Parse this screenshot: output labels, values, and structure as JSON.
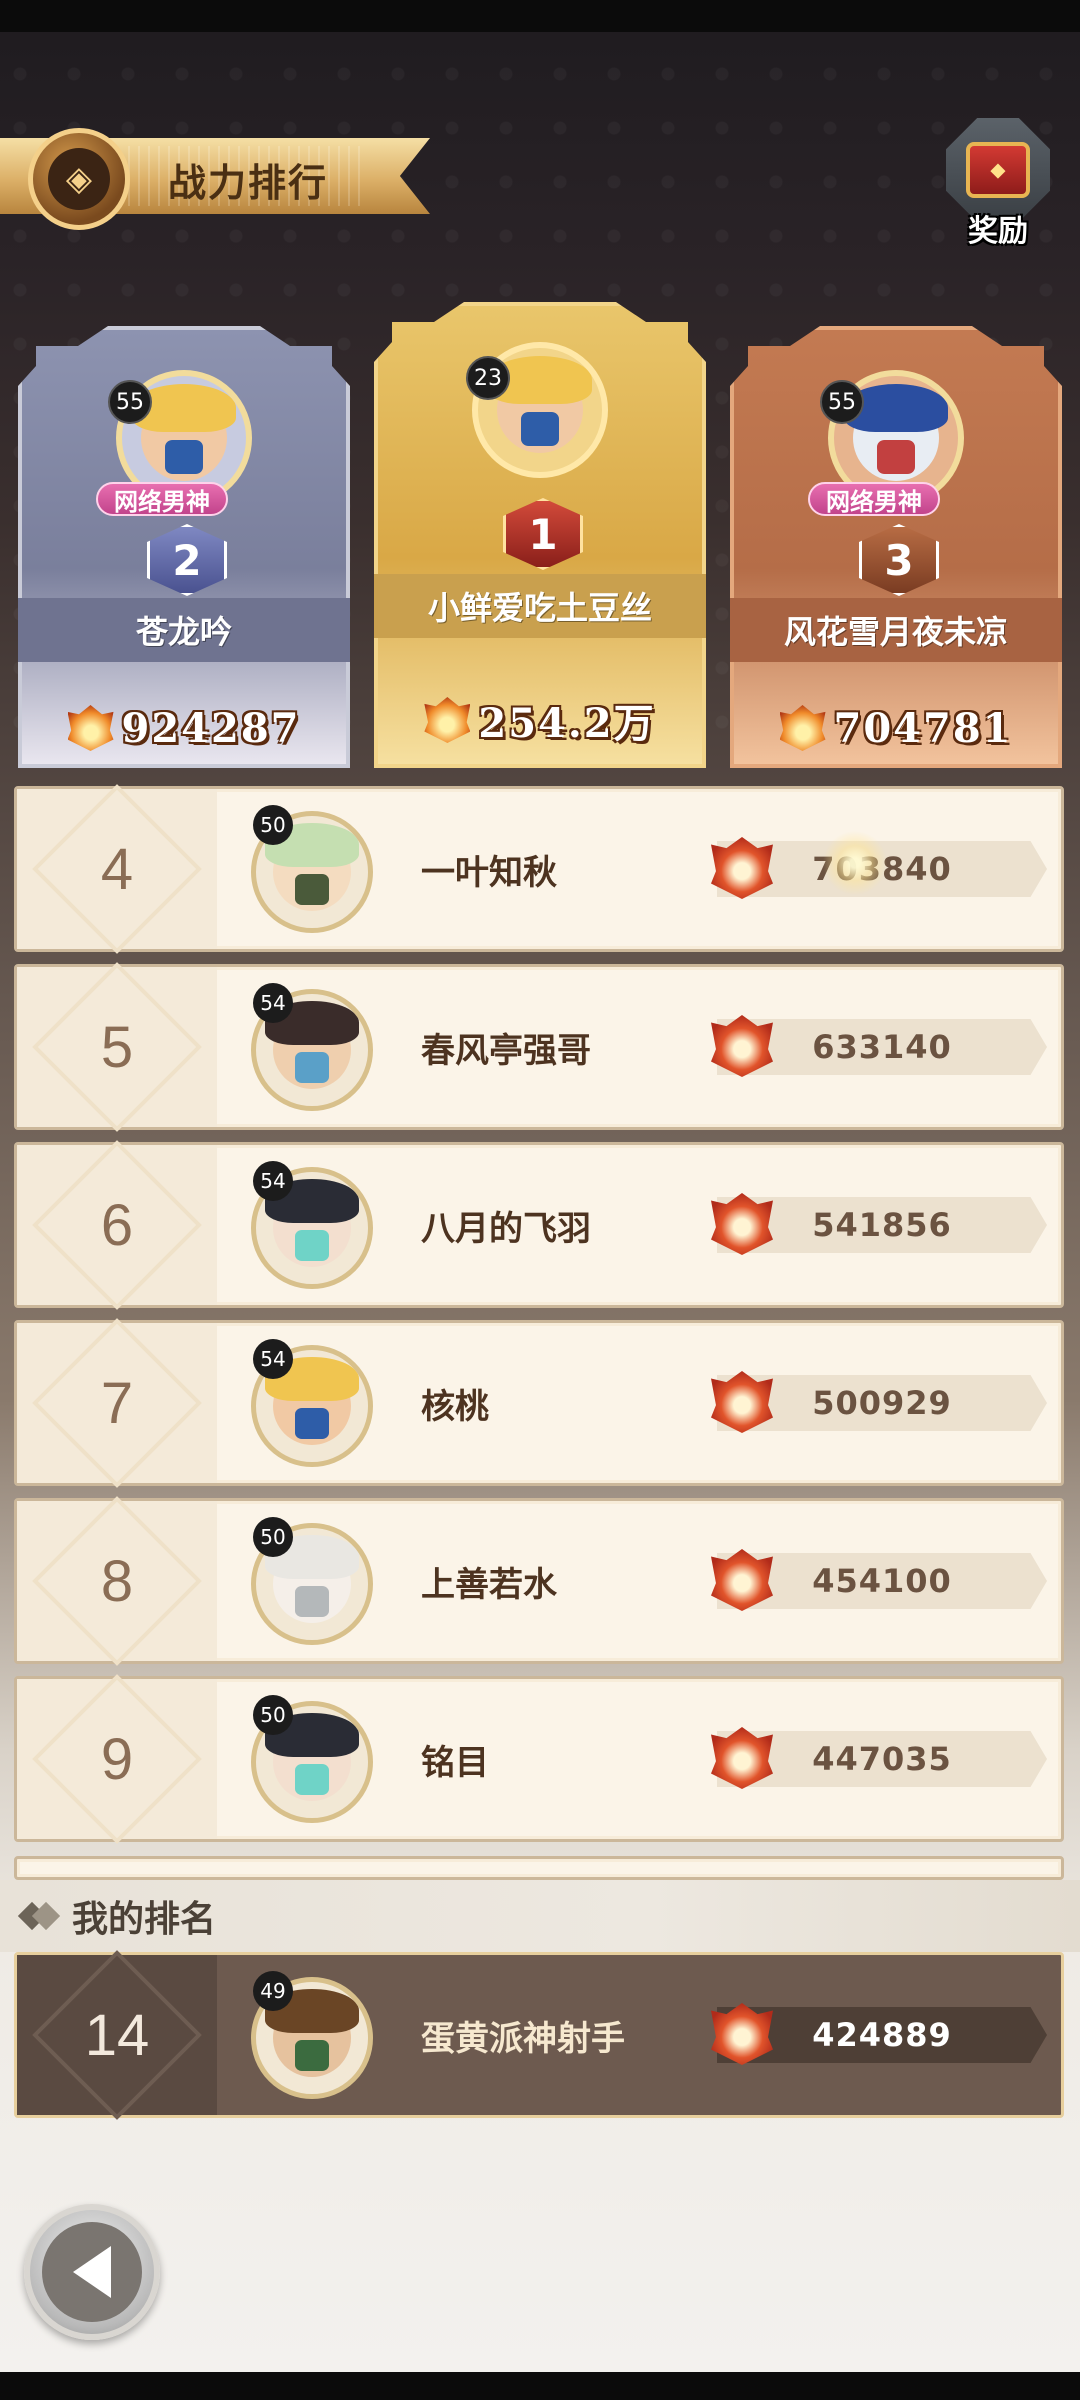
{
  "header": {
    "title": "战力排行",
    "reward_label": "奖励"
  },
  "podium": [
    {
      "rank": "2",
      "level": "55",
      "name": "苍龙吟",
      "power": "924287",
      "tag": "网络男神",
      "avatar": "blond-swordsman"
    },
    {
      "rank": "1",
      "level": "23",
      "name": "小鲜爱吃土豆丝",
      "power": "254.2万",
      "tag": "",
      "avatar": "blond-swordsman"
    },
    {
      "rank": "3",
      "level": "55",
      "name": "风花雪月夜未凉",
      "power": "704781",
      "tag": "网络男神",
      "avatar": "blue-dragon"
    }
  ],
  "list": [
    {
      "rank": "4",
      "level": "50",
      "name": "一叶知秋",
      "power": "703840",
      "avatar": "green-hair"
    },
    {
      "rank": "5",
      "level": "54",
      "name": "春风亭强哥",
      "power": "633140",
      "avatar": "dark-hair"
    },
    {
      "rank": "6",
      "level": "54",
      "name": "八月的飞羽",
      "power": "541856",
      "avatar": "teal-mage"
    },
    {
      "rank": "7",
      "level": "54",
      "name": "核桃",
      "power": "500929",
      "avatar": "blond-swordsman"
    },
    {
      "rank": "8",
      "level": "50",
      "name": "上善若水",
      "power": "454100",
      "avatar": "white-hair"
    },
    {
      "rank": "9",
      "level": "50",
      "name": "铭目",
      "power": "447035",
      "avatar": "teal-mage"
    }
  ],
  "my_rank": {
    "header": "我的排名",
    "rank": "14",
    "level": "49",
    "name": "蛋黄派神射手",
    "power": "424889",
    "avatar": "hat-archer"
  },
  "colors": {
    "gold": "#e0b45a",
    "silver": "#8a90a8",
    "bronze": "#d98c5b",
    "row_bg": "#fbf4e8",
    "my_row_bg": "#6d5a4f"
  }
}
